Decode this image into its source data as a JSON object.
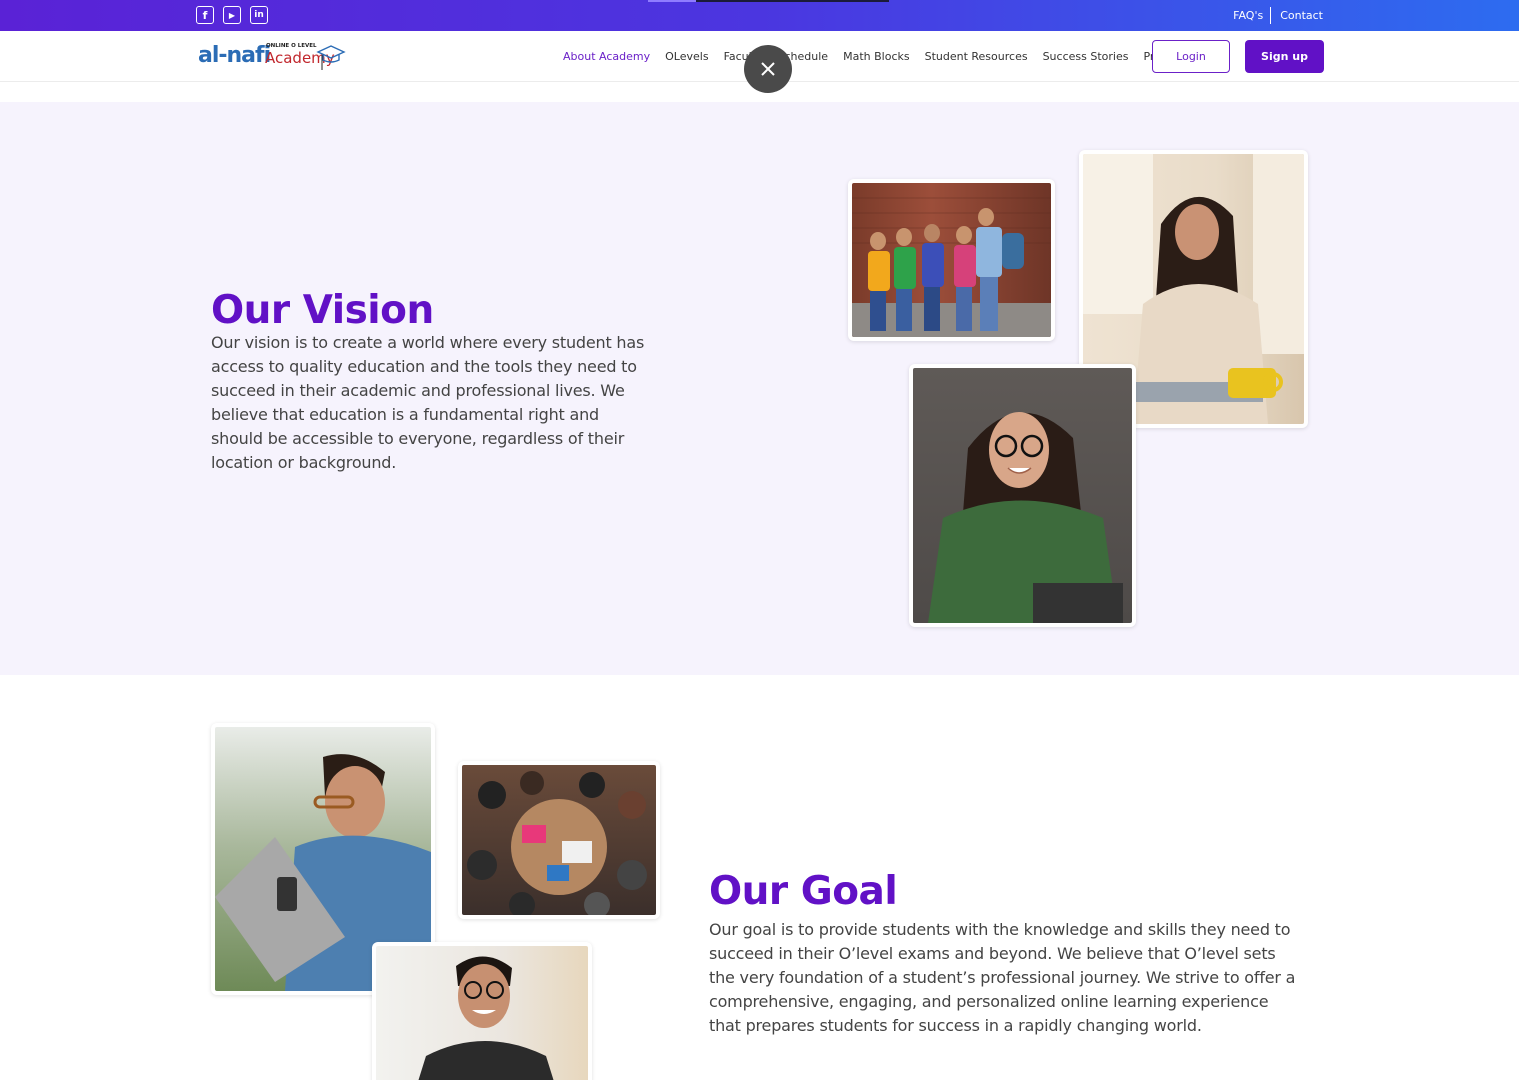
{
  "topbar": {
    "social": [
      {
        "name": "facebook-icon",
        "glyph": "f"
      },
      {
        "name": "youtube-icon",
        "glyph": "▶"
      },
      {
        "name": "linkedin-icon",
        "glyph": "in"
      }
    ],
    "faq": "FAQ's",
    "contact": "Contact",
    "progress": 0.2
  },
  "logo": {
    "brand": "al-nafi",
    "tagline": "ONLINE O LEVEL",
    "academy": "Academy"
  },
  "nav": {
    "items": [
      "About Academy",
      "OLevels",
      "Faculty",
      "Schedule",
      "Math Blocks",
      "Student Resources",
      "Success Stories",
      "Pricing"
    ],
    "active": "About Academy",
    "login": "Login",
    "signup": "Sign up"
  },
  "vision": {
    "title": "Our Vision",
    "text": "Our vision is to create a world where every student has access to quality education and the tools they need to succeed in their academic and professional lives. We believe that education is a fundamental right and should be accessible to everyone, regardless of their location or background."
  },
  "goal": {
    "title": "Our Goal",
    "text": "Our goal is to provide students with the knowledge and skills they need to succeed in their O’level exams and beyond. We believe that O’level sets the very foundation of a student’s professional journey. We strive to offer a comprehensive, engaging, and personalized online learning experience that prepares students for success in a rapidly changing world."
  },
  "colors": {
    "brand_purple": "#6111c6",
    "vision_bg": "#f6f3fd"
  }
}
